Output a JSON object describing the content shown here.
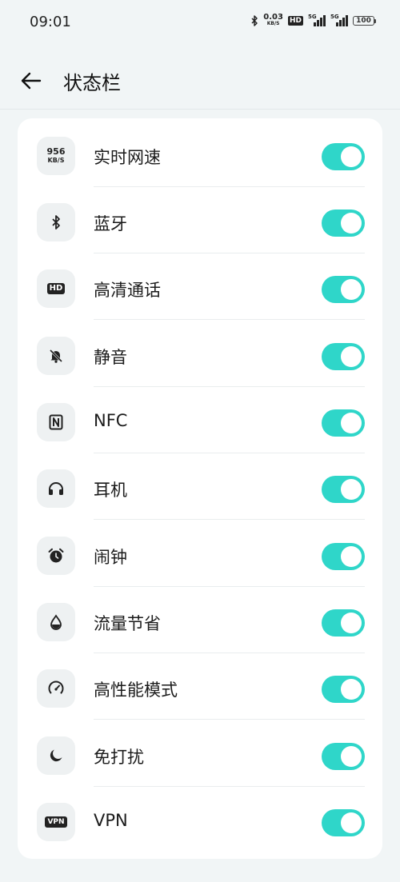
{
  "status_bar": {
    "time": "09:01",
    "net_speed_value": "0.03",
    "net_speed_unit": "KB/S",
    "hd_label": "HD",
    "sim1_label": "5G",
    "sim2_label": "5G",
    "battery_level": "100"
  },
  "header": {
    "title": "状态栏"
  },
  "colors": {
    "toggle_on": "#2fd6c9",
    "background": "#f1f5f6",
    "card": "#ffffff",
    "icon_tile": "#eef1f2"
  },
  "settings": {
    "items": [
      {
        "label": "实时网速",
        "icon": "net-speed-icon",
        "icon_text_top": "956",
        "icon_text_bottom": "KB/S",
        "enabled": true
      },
      {
        "label": "蓝牙",
        "icon": "bluetooth-icon",
        "enabled": true
      },
      {
        "label": "高清通话",
        "icon": "hd-call-icon",
        "icon_text": "HD",
        "enabled": true
      },
      {
        "label": "静音",
        "icon": "mute-bell-icon",
        "enabled": true
      },
      {
        "label": "NFC",
        "icon": "nfc-icon",
        "enabled": true
      },
      {
        "label": "耳机",
        "icon": "headphones-icon",
        "enabled": true
      },
      {
        "label": "闹钟",
        "icon": "alarm-clock-icon",
        "enabled": true
      },
      {
        "label": "流量节省",
        "icon": "water-drop-icon",
        "enabled": true
      },
      {
        "label": "高性能模式",
        "icon": "speedometer-icon",
        "enabled": true
      },
      {
        "label": "免打扰",
        "icon": "moon-icon",
        "enabled": true
      },
      {
        "label": "VPN",
        "icon": "vpn-icon",
        "icon_text": "VPN",
        "enabled": true
      }
    ]
  }
}
